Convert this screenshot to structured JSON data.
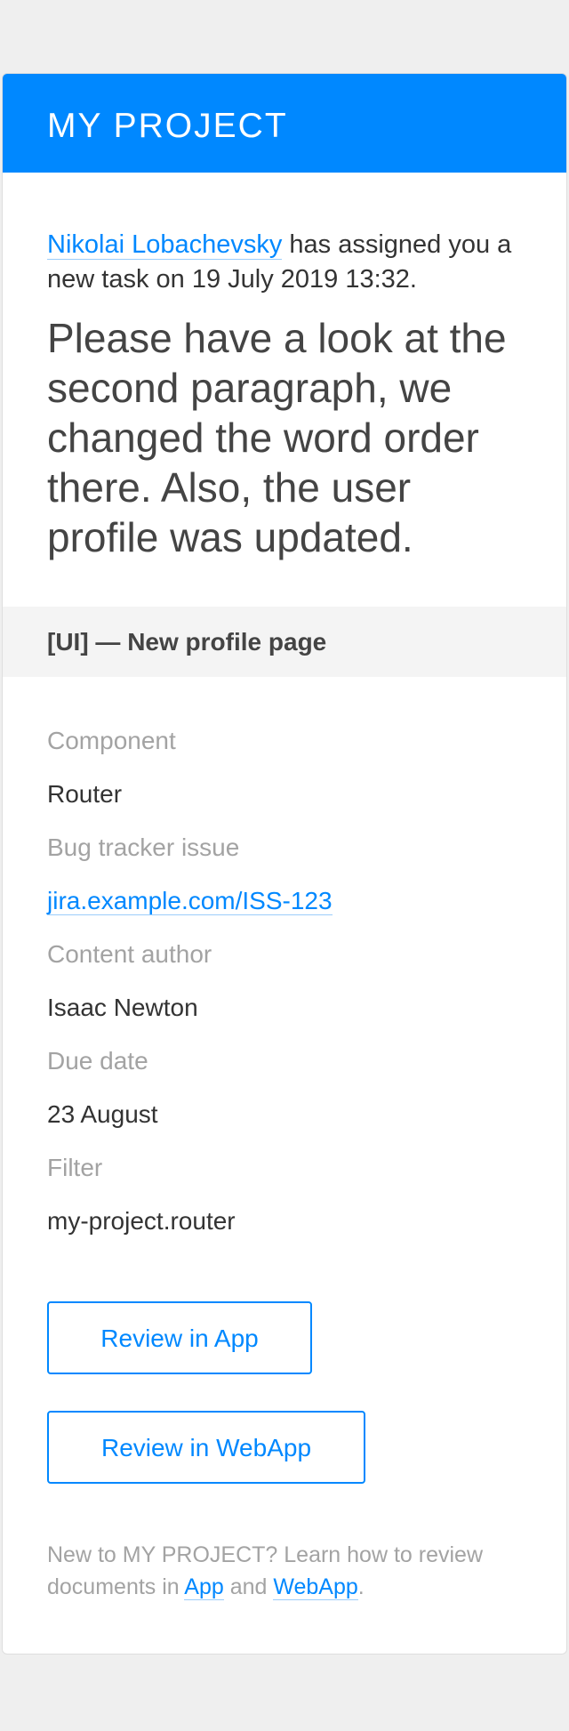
{
  "header": {
    "project_name": "MY PROJECT"
  },
  "intro": {
    "assigner_name": "Nikolai Lobachevsky",
    "assign_text": " has assigned you a new task on 19 July 2019 13:32.",
    "message": "Please have a look at the second paragraph, we changed the word order there. Also, the user profile was updated."
  },
  "task": {
    "title": "[UI] — New profile page"
  },
  "details": {
    "component_label": "Component",
    "component_value": "Router",
    "bug_label": "Bug tracker issue",
    "bug_value": "jira.example.com/ISS-123",
    "author_label": "Content author",
    "author_value": "Isaac Newton",
    "due_label": "Due date",
    "due_value": "23 August",
    "filter_label": "Filter",
    "filter_value": "my-project.router"
  },
  "buttons": {
    "review_app": "Review in App",
    "review_webapp": "Review in WebApp"
  },
  "footer": {
    "text_before": "New to MY PROJECT? Learn how to review documents in ",
    "app_link": "App",
    "and_text": " and ",
    "webapp_link": "WebApp",
    "end_text": "."
  },
  "colors": {
    "accent": "#0088ff",
    "background": "#efefef",
    "card": "#ffffff",
    "task_bar": "#f4f4f4",
    "muted_text": "#a3a3a3"
  }
}
